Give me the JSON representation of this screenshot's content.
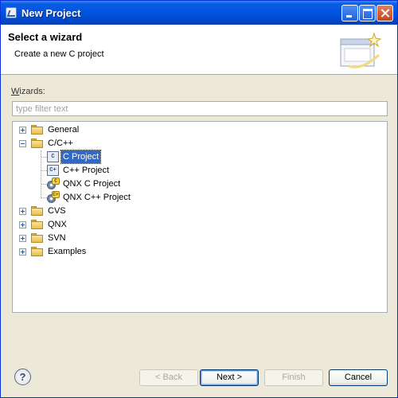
{
  "window": {
    "title": "New Project"
  },
  "header": {
    "heading": "Select a wizard",
    "description": "Create a new C project",
    "banner_icon": "wizard-banner-icon"
  },
  "wizards": {
    "label": "Wizards:",
    "label_mnemonic": "W",
    "label_rest": "izards:",
    "filter_placeholder": "type filter text"
  },
  "tree": {
    "items": [
      {
        "label": "General",
        "expanded": false,
        "icon": "folder-icon"
      },
      {
        "label": "C/C++",
        "expanded": true,
        "icon": "folder-icon",
        "children": [
          {
            "label": "C Project",
            "icon": "c-project-icon",
            "selected": true
          },
          {
            "label": "C++ Project",
            "icon": "cpp-project-icon"
          },
          {
            "label": "QNX C Project",
            "icon": "qnx-c-project-icon"
          },
          {
            "label": "QNX C++ Project",
            "icon": "qnx-cpp-project-icon"
          }
        ]
      },
      {
        "label": "CVS",
        "expanded": false,
        "icon": "folder-icon"
      },
      {
        "label": "QNX",
        "expanded": false,
        "icon": "folder-icon"
      },
      {
        "label": "SVN",
        "expanded": false,
        "icon": "folder-icon"
      },
      {
        "label": "Examples",
        "expanded": false,
        "icon": "folder-icon"
      }
    ]
  },
  "buttons": {
    "help": "?",
    "back": "< Back",
    "next": "Next >",
    "finish": "Finish",
    "cancel": "Cancel"
  },
  "colors": {
    "titlebar": "#0053e1",
    "selection": "#316ac5",
    "dialog_bg": "#ece9d8"
  }
}
